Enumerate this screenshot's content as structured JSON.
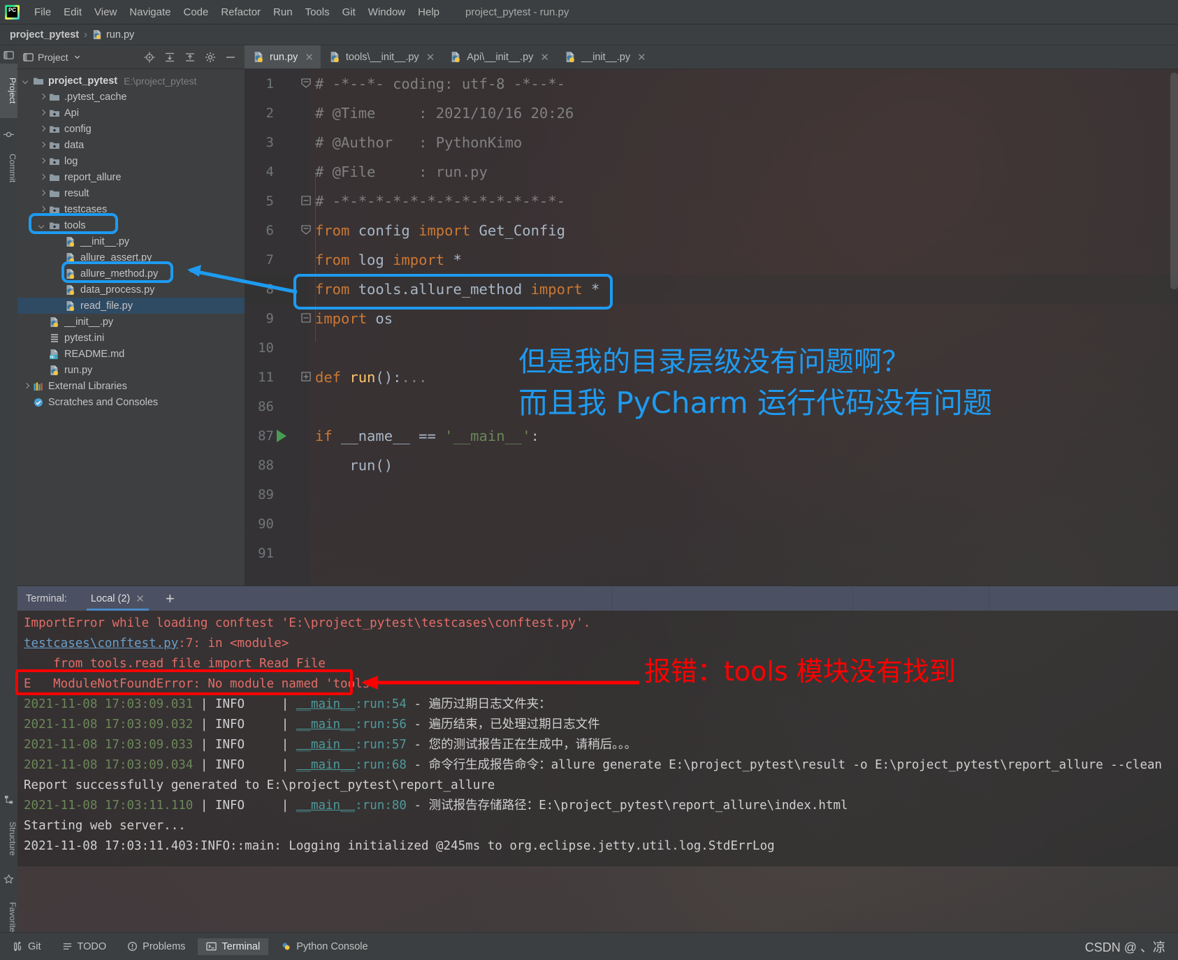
{
  "app": {
    "window_title": "project_pytest - run.py",
    "logo_text": "PC"
  },
  "menubar": {
    "items": [
      {
        "label": "File",
        "mnemonic": "F"
      },
      {
        "label": "Edit",
        "mnemonic": "E"
      },
      {
        "label": "View",
        "mnemonic": "V"
      },
      {
        "label": "Navigate",
        "mnemonic": "N"
      },
      {
        "label": "Code",
        "mnemonic": "C"
      },
      {
        "label": "Refactor",
        "mnemonic": "R"
      },
      {
        "label": "Run",
        "mnemonic": "u"
      },
      {
        "label": "Tools",
        "mnemonic": "T"
      },
      {
        "label": "Git",
        "mnemonic": "G"
      },
      {
        "label": "Window",
        "mnemonic": "W"
      },
      {
        "label": "Help",
        "mnemonic": "H"
      }
    ]
  },
  "breadcrumb": {
    "project": "project_pytest",
    "separator": "›",
    "file": "run.py"
  },
  "left_strip": {
    "project_tab": "Project",
    "commit_tab": "Commit",
    "structure_tab": "Structure",
    "favorites_tab": "Favorites"
  },
  "project_panel": {
    "title": "Project",
    "tree": [
      {
        "indent": 0,
        "arrow": "open",
        "icon": "folder",
        "label": "project_pytest",
        "bold": true,
        "path": "E:\\project_pytest"
      },
      {
        "indent": 1,
        "arrow": "closed",
        "icon": "folder",
        "label": ".pytest_cache",
        "bold": false,
        "path": ""
      },
      {
        "indent": 1,
        "arrow": "closed",
        "icon": "folder-source",
        "label": "Api",
        "bold": false,
        "path": ""
      },
      {
        "indent": 1,
        "arrow": "closed",
        "icon": "folder-source",
        "label": "config",
        "bold": false,
        "path": ""
      },
      {
        "indent": 1,
        "arrow": "closed",
        "icon": "folder-source",
        "label": "data",
        "bold": false,
        "path": ""
      },
      {
        "indent": 1,
        "arrow": "closed",
        "icon": "folder-source",
        "label": "log",
        "bold": false,
        "path": ""
      },
      {
        "indent": 1,
        "arrow": "closed",
        "icon": "folder",
        "label": "report_allure",
        "bold": false,
        "path": ""
      },
      {
        "indent": 1,
        "arrow": "closed",
        "icon": "folder",
        "label": "result",
        "bold": false,
        "path": ""
      },
      {
        "indent": 1,
        "arrow": "closed",
        "icon": "folder-source",
        "label": "testcases",
        "bold": false,
        "path": ""
      },
      {
        "indent": 1,
        "arrow": "open",
        "icon": "folder-source",
        "label": "tools",
        "bold": false,
        "path": ""
      },
      {
        "indent": 2,
        "arrow": "none",
        "icon": "python",
        "label": "__init__.py",
        "bold": false,
        "path": ""
      },
      {
        "indent": 2,
        "arrow": "none",
        "icon": "python",
        "label": "allure_assert.py",
        "bold": false,
        "path": ""
      },
      {
        "indent": 2,
        "arrow": "none",
        "icon": "python",
        "label": "allure_method.py",
        "bold": false,
        "path": ""
      },
      {
        "indent": 2,
        "arrow": "none",
        "icon": "python",
        "label": "data_process.py",
        "bold": false,
        "path": ""
      },
      {
        "indent": 2,
        "arrow": "none",
        "icon": "python",
        "label": "read_file.py",
        "bold": false,
        "path": "",
        "selected": true
      },
      {
        "indent": 1,
        "arrow": "none",
        "icon": "python",
        "label": "__init__.py",
        "bold": false,
        "path": ""
      },
      {
        "indent": 1,
        "arrow": "none",
        "icon": "ini",
        "label": "pytest.ini",
        "bold": false,
        "path": ""
      },
      {
        "indent": 1,
        "arrow": "none",
        "icon": "md",
        "label": "README.md",
        "bold": false,
        "path": ""
      },
      {
        "indent": 1,
        "arrow": "none",
        "icon": "python",
        "label": "run.py",
        "bold": false,
        "path": ""
      },
      {
        "indent": 0,
        "arrow": "closed",
        "icon": "library",
        "label": "External Libraries",
        "bold": false,
        "path": ""
      },
      {
        "indent": 0,
        "arrow": "none",
        "icon": "scratch",
        "label": "Scratches and Consoles",
        "bold": false,
        "path": ""
      }
    ]
  },
  "editor_tabs": [
    {
      "label": "run.py",
      "active": true
    },
    {
      "label": "tools\\__init__.py",
      "active": false
    },
    {
      "label": "Api\\__init__.py",
      "active": false
    },
    {
      "label": "__init__.py",
      "active": false
    }
  ],
  "editor": {
    "lines": [
      {
        "num": "1",
        "fold": "collapse-top",
        "text": "# -*--*- coding: utf-8 -*--*-",
        "cls": "k-com"
      },
      {
        "num": "2",
        "fold": "",
        "text": "# @Time     : 2021/10/16 20:26",
        "cls": "k-com"
      },
      {
        "num": "3",
        "fold": "",
        "text": "# @Author   : PythonKimo",
        "cls": "k-com"
      },
      {
        "num": "4",
        "fold": "",
        "text": "# @File     : run.py",
        "cls": "k-com"
      },
      {
        "num": "5",
        "fold": "collapse-end",
        "text": "# -*-*-*-*-*-*-*-*-*-*-*-*-*-",
        "cls": "k-com"
      },
      {
        "num": "6",
        "fold": "collapse-top",
        "text": "",
        "html": "<span class='k-kw'>from</span> <span class='k-id'>config</span> <span class='k-kw'>import</span> <span class='k-id'>Get_Config</span>"
      },
      {
        "num": "7",
        "fold": "",
        "text": "",
        "html": "<span class='k-kw'>from</span> <span class='k-id'>log</span> <span class='k-kw'>import</span> <span class='k-id'>*</span>"
      },
      {
        "num": "8",
        "fold": "",
        "text": "",
        "html": "<span class='k-kw'>from</span> <span class='k-id'>tools.allure_method</span> <span class='k-kw'>import</span> <span class='k-id'>*</span>"
      },
      {
        "num": "9",
        "fold": "collapse-end",
        "text": "",
        "html": "<span class='k-kw'>import</span> <span class='k-id'>os</span>"
      },
      {
        "num": "10",
        "fold": "",
        "text": "",
        "html": ""
      },
      {
        "num": "11",
        "fold": "expand",
        "text": "",
        "html": "<span class='k-kw'>def</span> <span class='k-fn'>run</span><span class='k-id'>()</span><span class='k-id'>:</span><span class='k-dots'>...</span>"
      },
      {
        "num": "86",
        "fold": "",
        "text": "",
        "html": ""
      },
      {
        "num": "87",
        "fold": "",
        "text": "",
        "html": "<span class='k-kw'>if</span> <span class='k-id'>__name__</span> <span class='k-id'>==</span> <span class='k-str'>'__main__'</span><span class='k-id'>:</span>",
        "runmark": true
      },
      {
        "num": "88",
        "fold": "",
        "text": "",
        "html": "    <span class='k-id'>run()</span>"
      },
      {
        "num": "89",
        "fold": "",
        "text": "",
        "html": ""
      },
      {
        "num": "90",
        "fold": "",
        "text": "",
        "html": ""
      },
      {
        "num": "91",
        "fold": "",
        "text": "",
        "html": ""
      }
    ]
  },
  "terminal": {
    "label": "Terminal:",
    "tab": "Local (2)",
    "add_label": "+",
    "lines": [
      {
        "html": "<span class='t-red'>ImportError while loading conftest 'E:\\project_pytest\\testcases\\conftest.py'.</span>"
      },
      {
        "html": "<span class='t-blue'>testcases\\conftest.py</span><span class='t-num'>:7</span><span class='t-red'>: in &lt;module&gt;</span>"
      },
      {
        "html": "<span class='t-red'>    from tools.read_file import Read_File</span>"
      },
      {
        "html": "<span class='t-red'>E   ModuleNotFoundError: No module named 'tools'</span>"
      },
      {
        "html": "<span class='t-green'>2021-11-08 17:03:09.031</span> <span class='t-white'>| </span><span class='t-white'>INFO</span><span class='t-white'>     | </span><span class='t-cyanu'>__main__</span><span class='t-cyan'>:</span><span class='t-cyan'>run</span><span class='t-cyan'>:</span><span class='t-ln'>54</span> <span class='t-white'>- 遍历过期日志文件夹：</span>"
      },
      {
        "html": "<span class='t-green'>2021-11-08 17:03:09.032</span> <span class='t-white'>| </span><span class='t-white'>INFO</span><span class='t-white'>     | </span><span class='t-cyanu'>__main__</span><span class='t-cyan'>:</span><span class='t-cyan'>run</span><span class='t-cyan'>:</span><span class='t-ln'>56</span> <span class='t-white'>- 遍历结束，已处理过期日志文件</span>"
      },
      {
        "html": "<span class='t-green'>2021-11-08 17:03:09.033</span> <span class='t-white'>| </span><span class='t-white'>INFO</span><span class='t-white'>     | </span><span class='t-cyanu'>__main__</span><span class='t-cyan'>:</span><span class='t-cyan'>run</span><span class='t-cyan'>:</span><span class='t-ln'>57</span> <span class='t-white'>- 您的测试报告正在生成中，请稍后。。。</span>"
      },
      {
        "html": "<span class='t-green'>2021-11-08 17:03:09.034</span> <span class='t-white'>| </span><span class='t-white'>INFO</span><span class='t-white'>     | </span><span class='t-cyanu'>__main__</span><span class='t-cyan'>:</span><span class='t-cyan'>run</span><span class='t-cyan'>:</span><span class='t-ln'>68</span> <span class='t-white'>- 命令行生成报告命令：allure generate E:\\project_pytest\\result -o E:\\project_pytest\\report_allure --clean</span>"
      },
      {
        "html": "<span class='t-white'>Report successfully generated to E:\\project_pytest\\report_allure</span>"
      },
      {
        "html": "<span class='t-green'>2021-11-08 17:03:11.110</span> <span class='t-white'>| </span><span class='t-white'>INFO</span><span class='t-white'>     | </span><span class='t-cyanu'>__main__</span><span class='t-cyan'>:</span><span class='t-cyan'>run</span><span class='t-cyan'>:</span><span class='t-ln'>80</span> <span class='t-white'>- 测试报告存储路径：E:\\project_pytest\\report_allure\\index.html</span>"
      },
      {
        "html": "<span class='t-white'>Starting web server...</span>"
      },
      {
        "html": "<span class='t-white'>2021-11-08 17:03:11.403:INFO::main: Logging initialized @245ms to org.eclipse.jetty.util.log.StdErrLog</span>"
      }
    ]
  },
  "statusbar": {
    "items": [
      {
        "label": "Git",
        "icon": "git-icon",
        "selected": false
      },
      {
        "label": "TODO",
        "icon": "todo-icon",
        "selected": false
      },
      {
        "label": "Problems",
        "icon": "problems-icon",
        "selected": false
      },
      {
        "label": "Terminal",
        "icon": "terminal-icon",
        "selected": true
      },
      {
        "label": "Python Console",
        "icon": "python-icon",
        "selected": false
      }
    ],
    "watermark": "CSDN @ 、凉"
  },
  "annotations": {
    "editor_note_line1": "但是我的目录层级没有问题啊？",
    "editor_note_line2": "而且我 PyCharm 运行代码没有问题",
    "terminal_note": "报错：tools 模块没有找到",
    "blue": "#1e9bf0",
    "red": "#ff0000"
  }
}
